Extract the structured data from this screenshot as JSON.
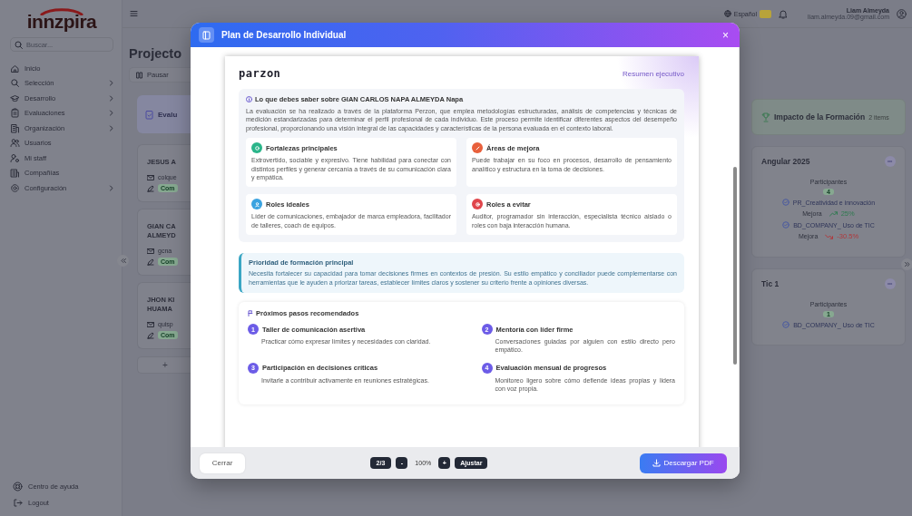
{
  "sidebar": {
    "logo": "innzpira",
    "search": {
      "placeholder": "Buscar..."
    },
    "items": [
      {
        "label": "Inicio",
        "has_submenu": false
      },
      {
        "label": "Selección",
        "has_submenu": true
      },
      {
        "label": "Desarrollo",
        "has_submenu": true
      },
      {
        "label": "Evaluaciones",
        "has_submenu": true
      },
      {
        "label": "Organización",
        "has_submenu": true
      },
      {
        "label": "Usuarios",
        "has_submenu": false
      },
      {
        "label": "Mi staff",
        "has_submenu": false
      },
      {
        "label": "Compañías",
        "has_submenu": false
      },
      {
        "label": "Configuración",
        "has_submenu": true
      }
    ],
    "footer_items": [
      "Centro de ayuda",
      "Logout"
    ]
  },
  "topbar": {
    "language": "Español",
    "user_name": "Liam Almeyda",
    "user_email": "liam.almeyda.09@gmail.com"
  },
  "project": {
    "title": "Projecto",
    "pause_button": "Pausar",
    "section_tab": "Evalu",
    "participants": [
      {
        "name_lines": [
          "JESUS A"
        ],
        "email": "colque",
        "status": "Com"
      },
      {
        "name_lines": [
          "GIAN CA",
          "ALMEYD"
        ],
        "email": "gcna",
        "status": "Com"
      },
      {
        "name_lines": [
          "JHON KI",
          "HUAMA"
        ],
        "email": "quisp",
        "status": "Com"
      }
    ],
    "add_button": "+"
  },
  "impact": {
    "title": "Impacto de la Formación",
    "count": "2 items",
    "trainings": [
      {
        "name": "Angular 2025",
        "participants_label": "Participantes",
        "participants": "4",
        "skills": [
          {
            "name": "PR_Creatividad e innovación",
            "label": "Mejora",
            "change": "25%",
            "kind": "up"
          },
          {
            "name": "BD_COMPANY_ Uso de TIC",
            "label": "Mejora",
            "change": "-30.5%",
            "kind": "down"
          }
        ]
      },
      {
        "name": "Tic 1",
        "participants_label": "Participantes",
        "participants": "1",
        "skills": [
          {
            "name": "BD_COMPANY_ Uso de TIC"
          }
        ]
      }
    ]
  },
  "modal": {
    "title": "Plan de Desarrollo Individual",
    "close": "×",
    "document": {
      "logo": "parzon",
      "section": "Resumen ejecutivo",
      "intro": {
        "title": "Lo que debes saber sobre GIAN CARLOS NAPA ALMEYDA Napa",
        "text": "La evaluación se ha realizado a través de la plataforma Perzon, que emplea metodologías estructuradas, análisis de competencias y técnicas de medición estandarizadas para determinar el perfil profesional de cada individuo. Este proceso permite identificar diferentes aspectos del desempeño profesional, proporcionando una visión integral de las capacidades y características de la persona evaluada en el contexto laboral."
      },
      "cards": [
        {
          "title": "Fortalezas principales",
          "text": "Extrovertido, sociable y expresivo. Tiene habilidad para conectar con distintos perfiles y generar cercanía a través de su comunicación clara y empática.",
          "color": "#2bb58a"
        },
        {
          "title": "Áreas de mejora",
          "text": "Puede trabajar en su foco en procesos, desarrollo de pensamiento analítico y estructura en la toma de decisiones.",
          "color": "#e8603c"
        },
        {
          "title": "Roles ideales",
          "text": "Líder de comunicaciones, embajador de marca empleadora, facilitador de talleres, coach de equipos.",
          "color": "#3aa3e0"
        },
        {
          "title": "Roles a evitar",
          "text": "Auditor, programador sin interacción, especialista técnico aislado o roles con baja interacción humana.",
          "color": "#e0454b"
        }
      ],
      "priority": {
        "title": "Prioridad de formación principal",
        "text": "Necesita fortalecer su capacidad para tomar decisiones firmes en contextos de presión. Su estilo empático y conciliador puede complementarse con herramientas que le ayuden a priorizar tareas, establecer límites claros y sostener su criterio frente a opiniones diversas."
      },
      "next_steps": {
        "title": "Próximos pasos recomendados",
        "steps": [
          {
            "number": "1",
            "title": "Taller de comunicación asertiva",
            "text": "Practicar cómo expresar límites y necesidades con claridad."
          },
          {
            "number": "2",
            "title": "Mentoría con líder firme",
            "text": "Conversaciones guiadas por alguien con estilo directo pero empático."
          },
          {
            "number": "3",
            "title": "Participación en decisiones críticas",
            "text": "Invitarle a contribuir activamente en reuniones estratégicas."
          },
          {
            "number": "4",
            "title": "Evaluación mensual de progresos",
            "text": "Monitoreo ligero sobre cómo defiende ideas propias y lidera con voz propia."
          }
        ]
      }
    },
    "footer": {
      "close_button": "Cerrar",
      "page": "2/3",
      "zoom_out": "-",
      "zoom": "100%",
      "zoom_in": "+",
      "fit_button": "Ajustar",
      "download_button": "Descargar PDF"
    }
  }
}
